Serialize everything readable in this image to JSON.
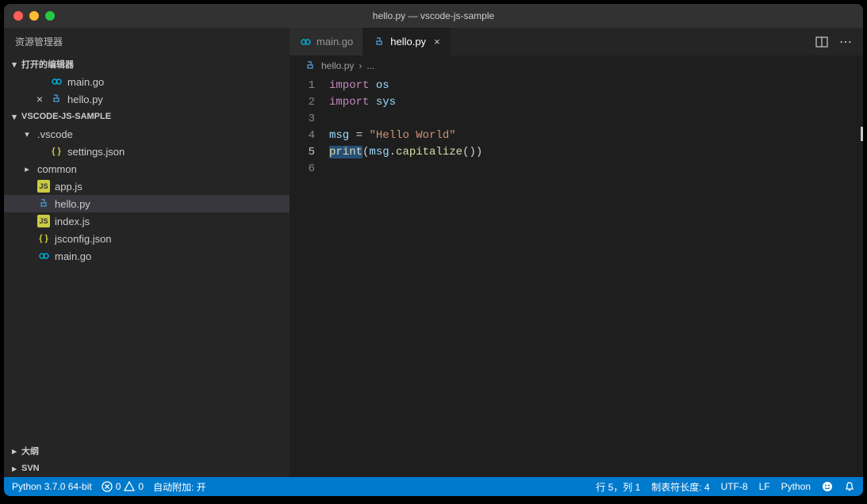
{
  "window": {
    "title": "hello.py — vscode-js-sample"
  },
  "sidebar": {
    "title": "资源管理器",
    "openEditorsLabel": "打开的编辑器",
    "openEditors": [
      {
        "name": "main.go",
        "iconType": "go",
        "modified": false
      },
      {
        "name": "hello.py",
        "iconType": "py",
        "modified": true
      }
    ],
    "projectLabel": "VSCODE-JS-SAMPLE",
    "files": [
      {
        "name": ".vscode",
        "type": "folder",
        "expanded": true,
        "depth": 1
      },
      {
        "name": "settings.json",
        "type": "json",
        "depth": 2
      },
      {
        "name": "common",
        "type": "folder",
        "expanded": false,
        "depth": 1
      },
      {
        "name": "app.js",
        "type": "js",
        "depth": 1
      },
      {
        "name": "hello.py",
        "type": "py",
        "depth": 1,
        "selected": true
      },
      {
        "name": "index.js",
        "type": "js",
        "depth": 1
      },
      {
        "name": "jsconfig.json",
        "type": "json",
        "depth": 1
      },
      {
        "name": "main.go",
        "type": "go",
        "depth": 1
      }
    ],
    "outlineLabel": "大纲",
    "svnLabel": "SVN"
  },
  "tabs": [
    {
      "name": "main.go",
      "iconType": "go",
      "active": false
    },
    {
      "name": "hello.py",
      "iconType": "py",
      "active": true,
      "closable": true
    }
  ],
  "breadcrumb": {
    "file": "hello.py",
    "more": "..."
  },
  "code": {
    "lines": [
      "1",
      "2",
      "3",
      "4",
      "5",
      "6"
    ],
    "currentLine": 5,
    "l1": {
      "kw": "import",
      "mod": "os"
    },
    "l2": {
      "kw": "import",
      "mod": "sys"
    },
    "l4": {
      "var": "msg",
      "op": " = ",
      "str": "\"Hello World\""
    },
    "l5": {
      "fn": "print",
      "open": "(",
      "var": "msg",
      "dot": ".",
      "method": "capitalize",
      "close": "())"
    }
  },
  "status": {
    "python": "Python 3.7.0 64-bit",
    "errors": "0",
    "warnings": "0",
    "autoAttach": "自动附加: 开",
    "lineCol": "行 5，列 1",
    "tabSize": "制表符长度: 4",
    "encoding": "UTF-8",
    "eol": "LF",
    "lang": "Python"
  }
}
